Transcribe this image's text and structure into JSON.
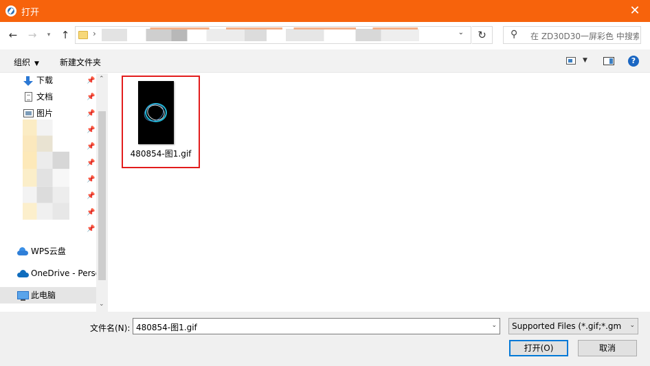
{
  "titlebar": {
    "title": "打开",
    "close_glyph": "✕"
  },
  "navbar": {
    "back_glyph": "←",
    "forward_glyph": "→",
    "recent_glyph": "▾",
    "up_glyph": "↑",
    "address_separator": "›",
    "address_dropdown_glyph": "⌄",
    "refresh_glyph": "↻",
    "search_icon_glyph": "⚲",
    "search_placeholder": "在 ZD30D30一屏彩色 中搜索"
  },
  "toolbar": {
    "organize_label": "组织",
    "organize_dd": "▼",
    "new_folder_label": "新建文件夹",
    "view_dd": "▼",
    "help_label": "?"
  },
  "sidebar": {
    "items": [
      {
        "label": "下载",
        "icon": "download-icon",
        "pinned": true
      },
      {
        "label": "文档",
        "icon": "document-icon",
        "pinned": true
      },
      {
        "label": "图片",
        "icon": "pictures-icon",
        "pinned": true
      },
      {
        "label": "WPS云盘",
        "icon": "wps-cloud-icon"
      },
      {
        "label": "OneDrive - Personal",
        "icon": "onedrive-icon"
      },
      {
        "label": "此电脑",
        "icon": "this-pc-icon",
        "selected": true
      }
    ],
    "pin_glyph": "📌",
    "scroll_up_glyph": "⌃",
    "scroll_down_glyph": "⌄"
  },
  "files": [
    {
      "name": "480854-图1.gif",
      "thumbnail": "black-gif-with-glowing-ring",
      "selected": true
    }
  ],
  "footer": {
    "filename_label": "文件名(N):",
    "filename_value": "480854-图1.gif",
    "filename_dd": "⌄",
    "filetype_value": "Supported Files (*.gif;*.gmov",
    "filetype_dd": "⌄",
    "open_label": "打开(O)",
    "cancel_label": "取消"
  },
  "colors": {
    "titlebar": "#f7630c",
    "selection_border": "#e21b1b",
    "default_button_border": "#0078d7"
  }
}
